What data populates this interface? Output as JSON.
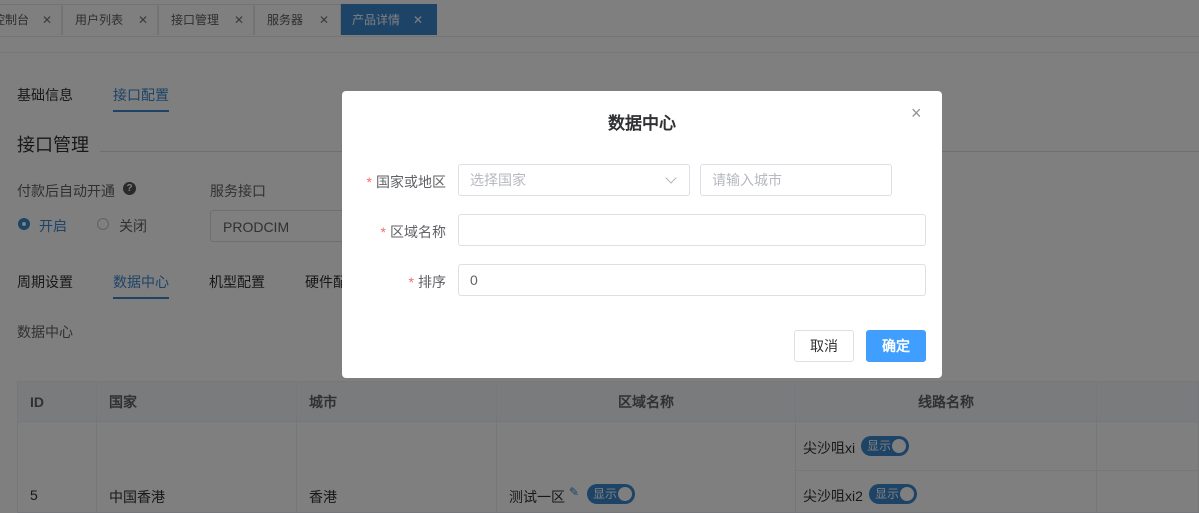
{
  "tabs": [
    {
      "label": "控制台",
      "active": false
    },
    {
      "label": "用户列表",
      "active": false
    },
    {
      "label": "接口管理",
      "active": false
    },
    {
      "label": "服务器",
      "active": false
    },
    {
      "label": "产品详情",
      "active": true
    }
  ],
  "top_tabs": {
    "basic": "基础信息",
    "api": "接口配置"
  },
  "section_title": "接口管理",
  "auto_open": {
    "label": "付款后自动开通",
    "on": "开启",
    "off": "关闭"
  },
  "service_api": {
    "label": "服务接口",
    "value": "PRODCIM"
  },
  "sub_tabs": {
    "cycle": "周期设置",
    "dc": "数据中心",
    "model": "机型配置",
    "hardware": "硬件配"
  },
  "dc_label": "数据中心",
  "table": {
    "headers": {
      "id": "ID",
      "country": "国家",
      "city": "城市",
      "zone": "区域名称",
      "line": "线路名称"
    },
    "row": {
      "id": "5",
      "country": "中国香港",
      "city": "香港",
      "zone": "测试一区",
      "zone_switch": "显示",
      "lines": [
        {
          "name": "尖沙咀xi",
          "switch": "显示"
        },
        {
          "name": "尖沙咀xi2",
          "switch": "显示"
        }
      ]
    }
  },
  "dialog": {
    "title": "数据中心",
    "country_label": "国家或地区",
    "country_placeholder": "选择国家",
    "city_placeholder": "请输入城市",
    "zone_label": "区域名称",
    "zone_value": "",
    "order_label": "排序",
    "order_value": "0",
    "cancel": "取消",
    "confirm": "确定",
    "close_icon": "×"
  },
  "colors": {
    "accent": "#3a87cf",
    "primary_button": "#409eff",
    "required": "#f56c6c"
  }
}
